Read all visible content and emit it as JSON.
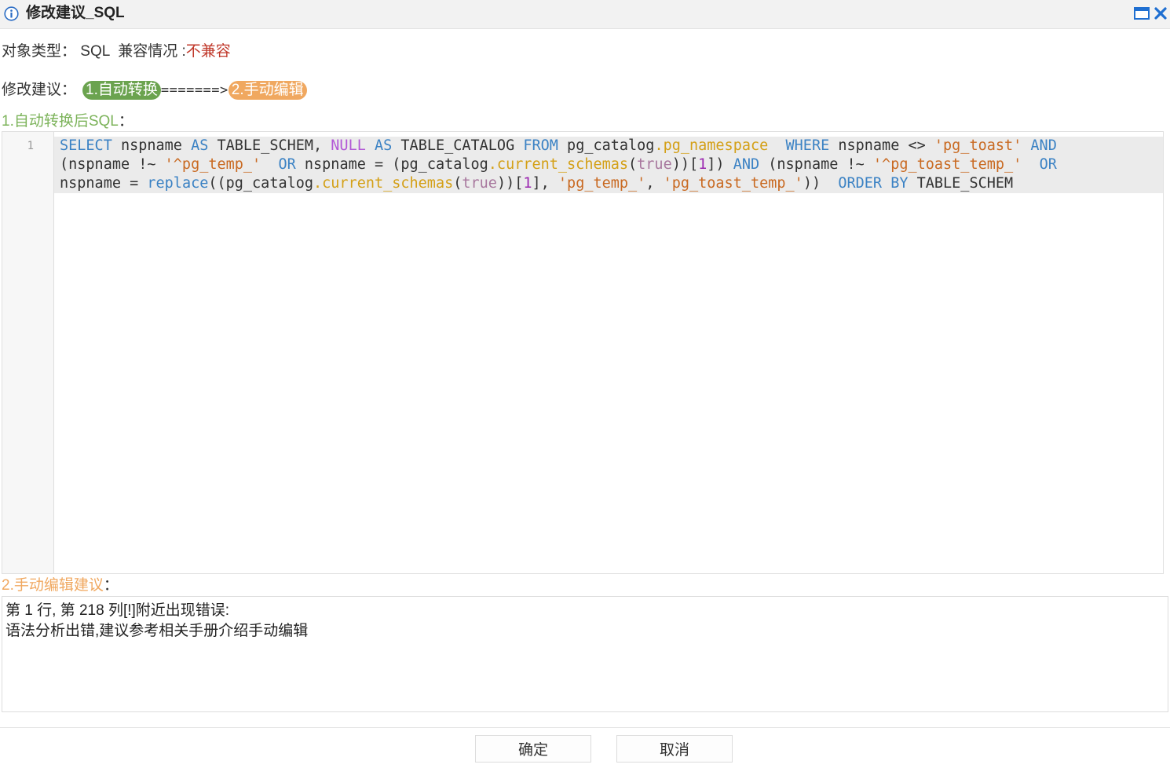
{
  "dialog": {
    "title": "修改建议_SQL",
    "icons": {
      "info": "info-icon",
      "maximize": "maximize-icon",
      "close": "close-icon"
    }
  },
  "object_type": {
    "label": "对象类型：",
    "value": "SQL",
    "compat_label": "兼容情况 :",
    "compat_value": "不兼容"
  },
  "advice_steps": {
    "label": "修改建议：",
    "step1": "1.自动转换",
    "arrow": "=======>",
    "step2": "2.手动编辑"
  },
  "section1": {
    "label": "1.自动转换后SQL",
    "colon": "："
  },
  "editor": {
    "line_number": "1",
    "lines": [
      [
        [
          "kw",
          "SELECT"
        ],
        [
          "plain",
          " nspname "
        ],
        [
          "kw",
          "AS"
        ],
        [
          "plain",
          " TABLE_SCHEM, "
        ],
        [
          "null",
          "NULL"
        ],
        [
          "plain",
          " "
        ],
        [
          "kw",
          "AS"
        ],
        [
          "plain",
          " TABLE_CATALOG "
        ],
        [
          "kw",
          "FROM"
        ],
        [
          "plain",
          " pg_catalog"
        ],
        [
          "fn",
          ".pg_namespace"
        ],
        [
          "plain",
          "  "
        ],
        [
          "kw",
          "WHERE"
        ],
        [
          "plain",
          " nspname <> "
        ],
        [
          "str",
          "'pg_toast'"
        ],
        [
          "plain",
          " "
        ],
        [
          "kw",
          "AND"
        ]
      ],
      [
        [
          "plain",
          "(nspname !~ "
        ],
        [
          "str",
          "'^pg_temp_'"
        ],
        [
          "plain",
          "  "
        ],
        [
          "kw",
          "OR"
        ],
        [
          "plain",
          " nspname = (pg_catalog"
        ],
        [
          "fn",
          ".current_schemas"
        ],
        [
          "plain",
          "("
        ],
        [
          "bool",
          "true"
        ],
        [
          "plain",
          "))["
        ],
        [
          "num",
          "1"
        ],
        [
          "plain",
          "]) "
        ],
        [
          "kw",
          "AND"
        ],
        [
          "plain",
          " (nspname !~ "
        ],
        [
          "str",
          "'^pg_toast_temp_'"
        ],
        [
          "plain",
          "  "
        ],
        [
          "kw",
          "OR"
        ]
      ],
      [
        [
          "plain",
          "nspname = "
        ],
        [
          "kw",
          "replace"
        ],
        [
          "plain",
          "((pg_catalog"
        ],
        [
          "fn",
          ".current_schemas"
        ],
        [
          "plain",
          "("
        ],
        [
          "bool",
          "true"
        ],
        [
          "plain",
          "))["
        ],
        [
          "num",
          "1"
        ],
        [
          "plain",
          "], "
        ],
        [
          "str",
          "'pg_temp_'"
        ],
        [
          "plain",
          ", "
        ],
        [
          "str",
          "'pg_toast_temp_'"
        ],
        [
          "plain",
          "))  "
        ],
        [
          "kw",
          "ORDER BY"
        ],
        [
          "plain",
          " TABLE_SCHEM"
        ]
      ]
    ]
  },
  "section2": {
    "label": "2.手动编辑建议",
    "colon": "："
  },
  "manual_advice": {
    "line1": "第 1 行, 第 218 列[!]附近出现错误:",
    "line2": "语法分析出错,建议参考相关手册介绍手动编辑"
  },
  "buttons": {
    "ok": "确定",
    "cancel": "取消"
  },
  "colors": {
    "titlebar": "#f2f2f2",
    "incompatible": "#c0392b",
    "step1_green": "#6ba34f",
    "step2_orange": "#f0a860",
    "keyword_blue": "#3b82c4",
    "string_orange": "#c96a22",
    "function_yellow": "#d4a017",
    "close_blue": "#1f6fd1"
  }
}
